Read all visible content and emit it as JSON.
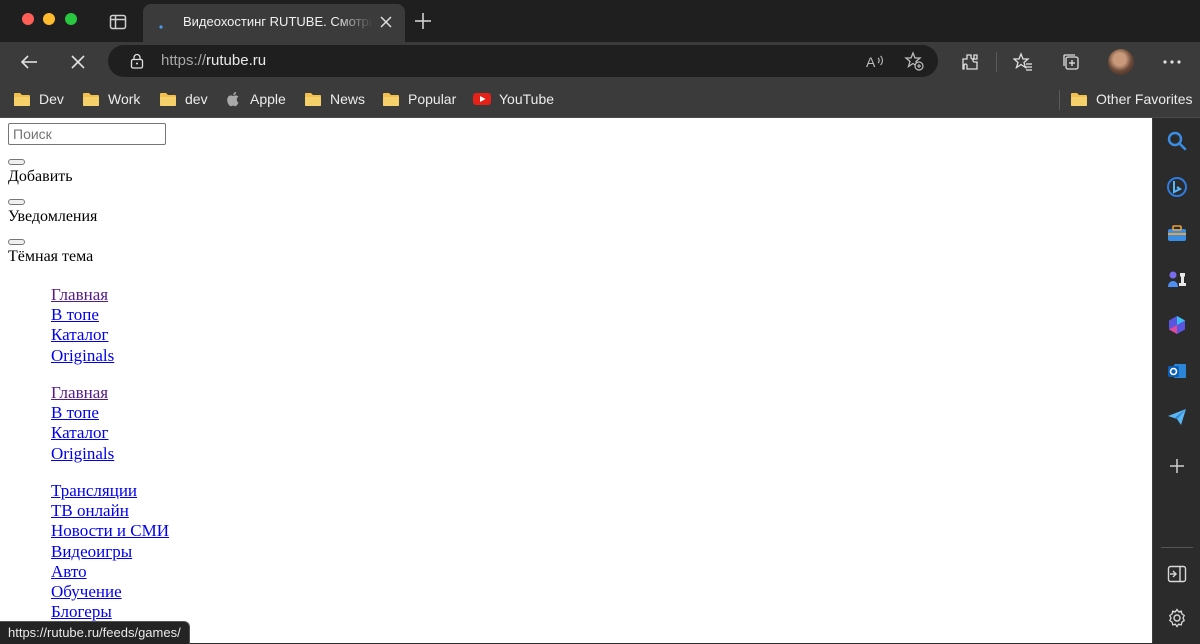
{
  "window": {
    "tab": {
      "title": "Видеохостинг RUTUBE. Смотрите видео онлайн"
    },
    "address": {
      "scheme": "https://",
      "host": "rutube.ru"
    }
  },
  "bookmarks": [
    {
      "label": "Dev",
      "icon": "folder-icon"
    },
    {
      "label": "Work",
      "icon": "folder-icon"
    },
    {
      "label": "dev",
      "icon": "folder-icon"
    },
    {
      "label": "Apple",
      "icon": "apple-icon"
    },
    {
      "label": "News",
      "icon": "folder-icon"
    },
    {
      "label": "Popular",
      "icon": "folder-icon"
    },
    {
      "label": "YouTube",
      "icon": "youtube-icon"
    }
  ],
  "other_favorites": {
    "label": "Other Favorites",
    "icon": "folder-icon"
  },
  "page": {
    "search": {
      "placeholder": "Поиск",
      "value": ""
    },
    "add_label": "Добавить",
    "notifications_label": "Уведомления",
    "dark_theme_label": "Тёмная тема",
    "nav_primary": [
      {
        "label": "Главная",
        "visited": true
      },
      {
        "label": "В топе",
        "visited": false
      },
      {
        "label": "Каталог",
        "visited": false
      },
      {
        "label": "Originals",
        "visited": false
      }
    ],
    "nav_secondary": [
      {
        "label": "Главная",
        "visited": true
      },
      {
        "label": "В топе",
        "visited": false
      },
      {
        "label": "Каталог",
        "visited": false
      },
      {
        "label": "Originals",
        "visited": false
      }
    ],
    "categories": [
      {
        "label": "Трансляции"
      },
      {
        "label": "ТВ онлайн"
      },
      {
        "label": "Новости и СМИ"
      },
      {
        "label": "Видеоигры"
      },
      {
        "label": "Авто"
      },
      {
        "label": "Обучение"
      },
      {
        "label": "Блогеры"
      }
    ]
  },
  "status_bar": {
    "url": "https://rutube.ru/feeds/games/"
  },
  "colors": {
    "link": "#0000ee",
    "visited_link": "#551a8b",
    "chrome_dark": "#1f1f1f",
    "chrome": "#3b3b3b"
  }
}
